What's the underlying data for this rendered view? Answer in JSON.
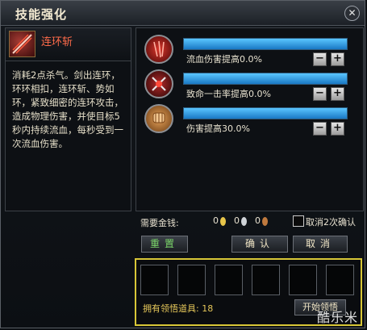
{
  "window": {
    "title": "技能强化",
    "close": "✕"
  },
  "skill": {
    "name": "连环斩",
    "description": "消耗2点杀气。剑出连环，环环相扣，连环斩、势如环，紧致细密的连环攻击，造成物理伤害，并使目标5秒内持续流血，每秒受到一次流血伤害。"
  },
  "stats": [
    {
      "label": "流血伤害提高0.0%",
      "fill_percent": 100,
      "icon": "blood-claw-icon"
    },
    {
      "label": "致命一击率提高0.0%",
      "fill_percent": 100,
      "icon": "crossed-blades-icon"
    },
    {
      "label": "伤害提高30.0%",
      "fill_percent": 100,
      "icon": "fist-icon"
    }
  ],
  "stepper": {
    "minus": "−",
    "plus": "+"
  },
  "money": {
    "label": "需要金钱:",
    "gold": "0",
    "silver": "0",
    "copper": "0",
    "gold_color": "#e8c64a",
    "silver_color": "#d0d4d8",
    "copper_color": "#c07a3e"
  },
  "confirm_checkbox": {
    "label": "取消2次确认"
  },
  "buttons": {
    "reset": "重置",
    "confirm": "确认",
    "cancel": "取消"
  },
  "inventory": {
    "owned_label": "拥有领悟道具: 18",
    "start_button": "开始领悟"
  },
  "watermark": "酷乐米",
  "colors": {
    "bar_fill": "#3aa6ec",
    "skill_name": "#ff6b4a",
    "highlight_border": "#d8c737"
  }
}
